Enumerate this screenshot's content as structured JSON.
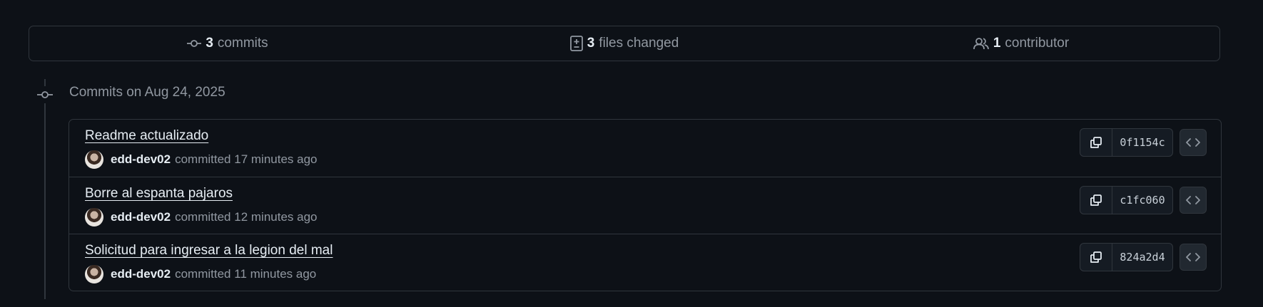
{
  "stats": {
    "commits": {
      "count": "3",
      "label": "commits",
      "icon": "git-commit-icon"
    },
    "files": {
      "count": "3",
      "label": "files changed",
      "icon": "file-diff-icon"
    },
    "contributors": {
      "count": "1",
      "label": "contributor",
      "icon": "people-icon"
    }
  },
  "group": {
    "heading": "Commits on Aug 24, 2025",
    "icon": "git-commit-icon"
  },
  "commits": [
    {
      "title": "Readme actualizado",
      "author": "edd-dev02",
      "action": "committed",
      "time": "17 minutes ago",
      "sha": "0f1154c"
    },
    {
      "title": "Borre al espanta pajaros",
      "author": "edd-dev02",
      "action": "committed",
      "time": "12 minutes ago",
      "sha": "c1fc060"
    },
    {
      "title": "Solicitud para ingresar a la legion del mal",
      "author": "edd-dev02",
      "action": "committed",
      "time": "11 minutes ago",
      "sha": "824a2d4"
    }
  ],
  "colors": {
    "background": "#0d1117",
    "border": "#30363d",
    "text_primary": "#e6edf3",
    "text_muted": "#9198a1"
  }
}
